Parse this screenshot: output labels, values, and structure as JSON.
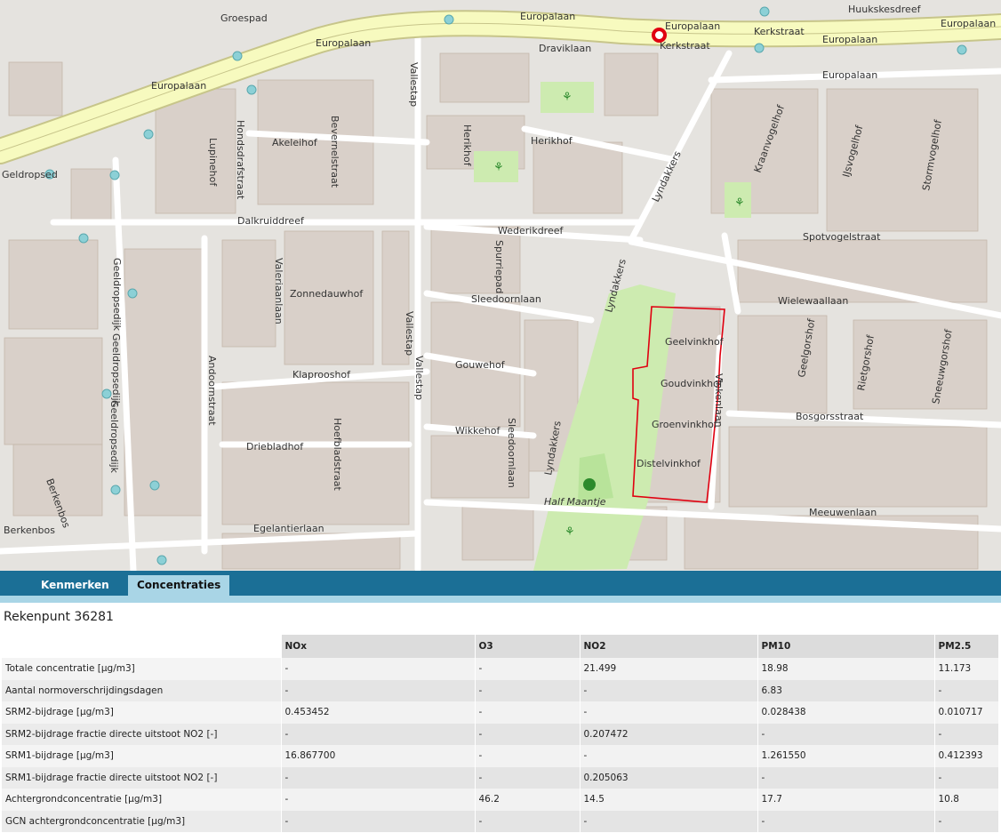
{
  "map": {
    "street_labels": {
      "europalaan": "Europalaan",
      "draviklaan": "Draviklaan",
      "vallestap": "Vallestap",
      "akeleihof": "Akeleihof",
      "bevernelstraat": "Bevernelstraat",
      "hondsdrafstraat": "Hondsdrafstraat",
      "lupinehof": "Lupinehof",
      "herikhof": "Herikhof",
      "lyndakkers": "Lyndakkers",
      "kraanvogelhof": "Kraanvogelhof",
      "ijsvogelhof": "IJsvogelhof",
      "stormvogelhof": "Stormvogelhof",
      "dalkruiddreef": "Dalkruiddreef",
      "wederikdreef": "Wederikdreef",
      "spotvogelstraat": "Spotvogelstraat",
      "wielewaallaan": "Wielewaallaan",
      "valeriaanlaan": "Valeriaanlaan",
      "zonnedauwhof": "Zonnedauwhof",
      "sleedoornlaan": "Sleedoornlaan",
      "spurriepad": "Spurriepad",
      "geeldropsedijk": "Geeldropsedijk",
      "klaprooshof": "Klaprooshof",
      "gouwehof": "Gouwehof",
      "andoornstraat": "Andoornstraat",
      "driebladhof": "Driebladhof",
      "hoefbladstraat": "Hoefbladstraat",
      "wikkehof": "Wikkehof",
      "geelvinkhof": "Geelvinkhof",
      "goudvinkhof": "Goudvinkhof",
      "groenvinkhof": "Groenvinkhof",
      "distelvinkhof": "Distelvinkhof",
      "vinkenlaan": "Vinkenlaan",
      "bosgorsstraat": "Bosgorsstraat",
      "geelgorshof": "Geelgorshof",
      "rietgorshof": "Rietgorshof",
      "sneeuwgorshof": "Sneeuwgorshof",
      "meeuwenlaan": "Meeuwenlaan",
      "egelantierlaan": "Egelantierlaan",
      "berkenbos": "Berkenbos",
      "groespad": "Groespad",
      "huukskesdreef": "Huukskesdreef",
      "kerkstraat": "Kerkstraat",
      "geldropsedijk_stop": "Geldropsed",
      "half_maantje": "Half Maantje"
    }
  },
  "tabs": [
    {
      "label": "Kenmerken",
      "active": false
    },
    {
      "label": "Concentraties",
      "active": true
    }
  ],
  "panel": {
    "title": "Rekenpunt 36281",
    "columns": [
      "",
      "NOx",
      "O3",
      "NO2",
      "PM10",
      "PM2.5"
    ],
    "rows": [
      [
        "Totale concentratie [µg/m3]",
        "-",
        "-",
        "21.499",
        "18.98",
        "11.173"
      ],
      [
        "Aantal normoverschrijdingsdagen",
        "-",
        "-",
        "-",
        "6.83",
        "-"
      ],
      [
        "SRM2-bijdrage [µg/m3]",
        "0.453452",
        "-",
        "-",
        "0.028438",
        "0.010717"
      ],
      [
        "SRM2-bijdrage fractie directe uitstoot NO2 [-]",
        "-",
        "-",
        "0.207472",
        "-",
        "-"
      ],
      [
        "SRM1-bijdrage [µg/m3]",
        "16.867700",
        "-",
        "-",
        "1.261550",
        "0.412393"
      ],
      [
        "SRM1-bijdrage fractie directe uitstoot NO2 [-]",
        "-",
        "-",
        "0.205063",
        "-",
        "-"
      ],
      [
        "Achtergrondconcentratie [µg/m3]",
        "-",
        "46.2",
        "14.5",
        "17.7",
        "10.8"
      ],
      [
        "GCN achtergrondconcentratie [µg/m3]",
        "-",
        "-",
        "-",
        "-",
        "-"
      ]
    ]
  },
  "colors": {
    "map_background": "#e5e3df",
    "road_major": "#f7fabf",
    "road_minor": "#ffffff",
    "park": "#cdebb0",
    "building": "#d9d0c9",
    "highlight_outline": "#e00010",
    "tab_bar": "#1b6f96",
    "tab_active": "#a9d5e6"
  },
  "icons": {
    "location_marker": "location-pin-icon",
    "bus_stop": "bus-stop-icon",
    "playground": "playground-icon",
    "dog_park": "dog-park-icon"
  }
}
